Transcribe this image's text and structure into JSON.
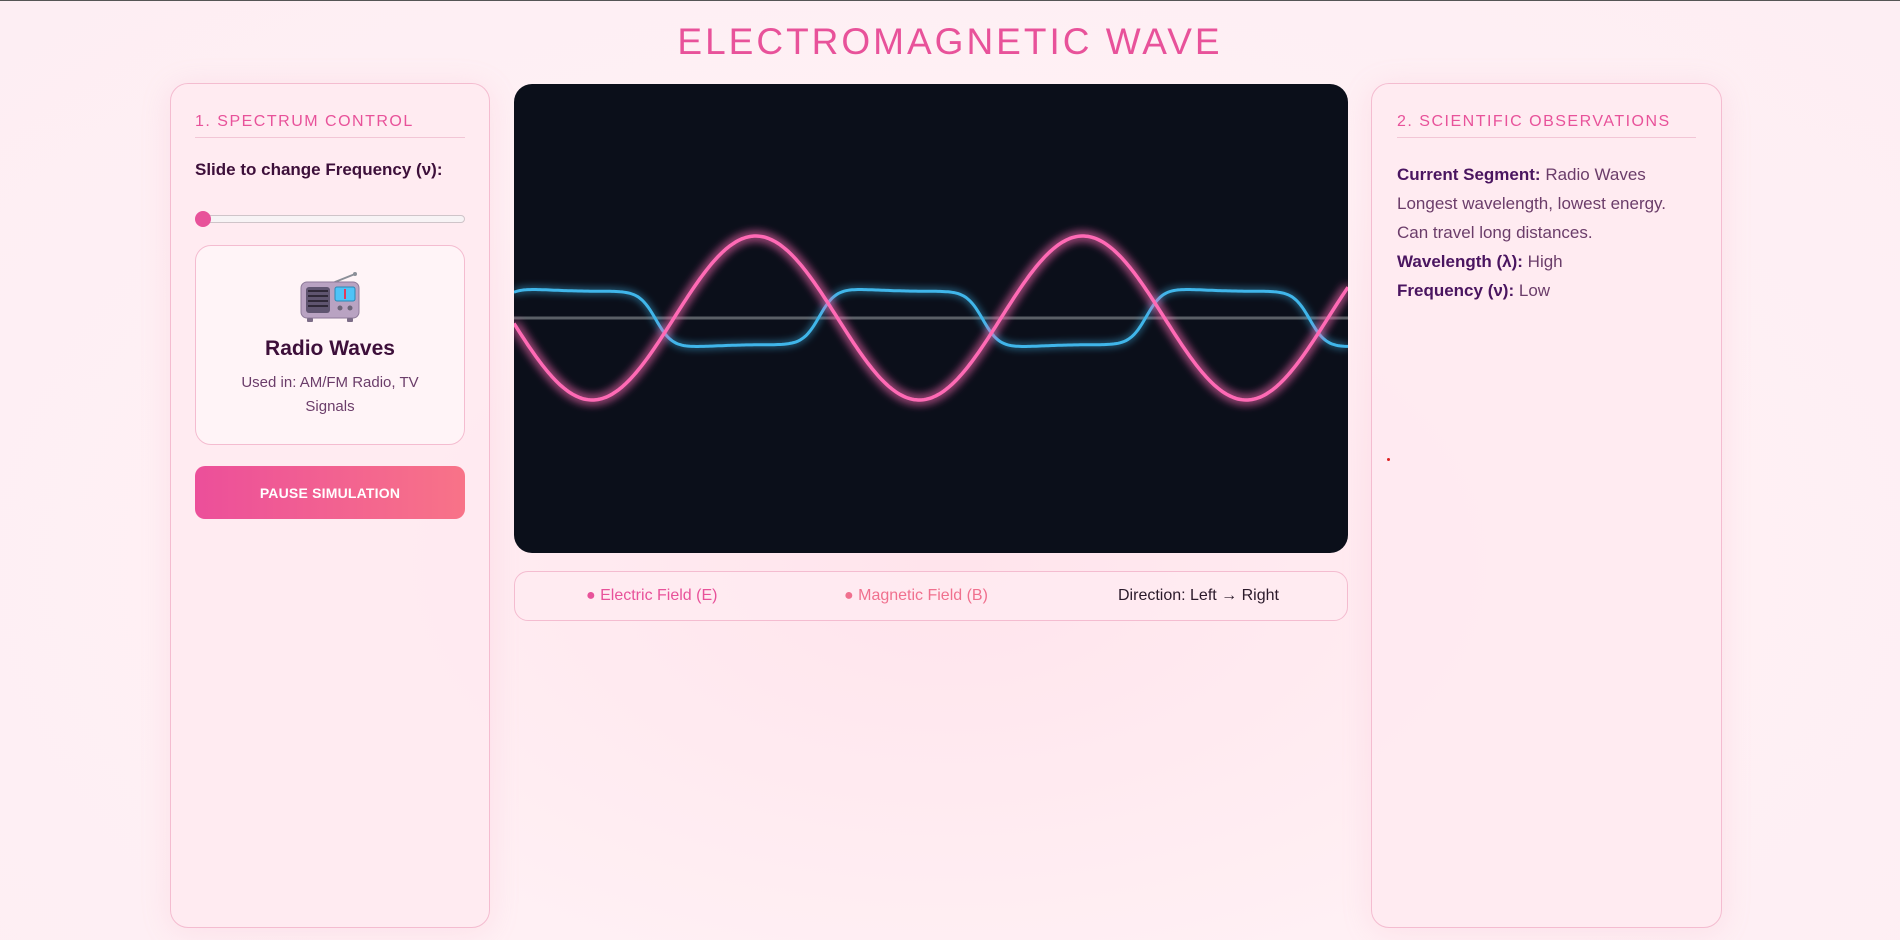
{
  "page": {
    "title": "ELECTROMAGNETIC WAVE"
  },
  "control_panel": {
    "heading": "1. SPECTRUM CONTROL",
    "slider_label": "Slide to change Frequency (ν):",
    "slider_value": 0,
    "wave_card": {
      "icon": "radio-icon",
      "name": "Radio Waves",
      "usage": "Used in: AM/FM Radio, TV Signals"
    },
    "pause_button": "PAUSE SIMULATION"
  },
  "legend": {
    "electric": "● Electric Field (E)",
    "magnetic": "● Magnetic Field (B)",
    "direction": "Direction: Left → Right"
  },
  "observations": {
    "heading": "2. SCIENTIFIC OBSERVATIONS",
    "segment_label": "Current Segment:",
    "segment_value": "Radio Waves",
    "description": "Longest wavelength, lowest energy. Can travel long distances.",
    "wavelength_label": "Wavelength (λ):",
    "wavelength_value": "High",
    "frequency_label": "Frequency (ν):",
    "frequency_value": "Low"
  },
  "colors": {
    "accent": "#e8529a",
    "electric_wave": "#ff6bb5",
    "magnetic_wave": "#3fb6ea",
    "canvas_bg": "#0b0f1a"
  }
}
